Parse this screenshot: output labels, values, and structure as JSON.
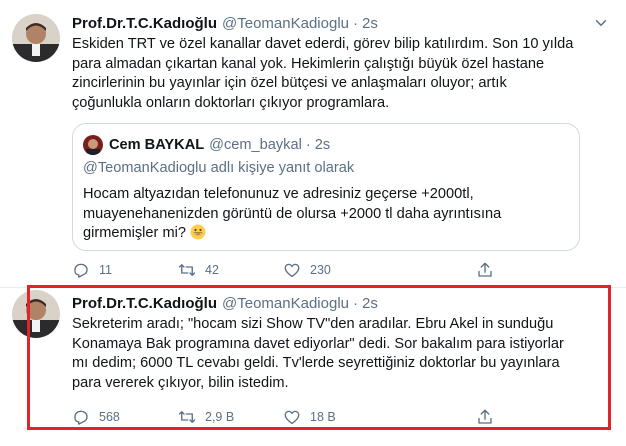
{
  "tweet1": {
    "name": "Prof.Dr.T.C.Kadıoğlu",
    "handle": "@TeomanKadioglu",
    "separator": "·",
    "time": "2s",
    "text": "Eskiden TRT ve özel kanallar davet ederdi, görev bilip katılırdım. Son 10 yılda\npara almadan çıkartan kanal yok. Hekimlerin çalıştığı büyük özel hastane\nzincirlerinin bu yayınlar için özel bütçesi ve anlaşmaları oluyor; artık\nçoğunlukla onların doktorları çıkıyor programlara.",
    "quote": {
      "name": "Cem BAYKAL",
      "handle": "@cem_baykal",
      "separator": "·",
      "time": "2s",
      "reply_context": "@TeomanKadioglu adlı kişiye yanıt olarak",
      "text": "Hocam altyazıdan telefonunuz ve adresiniz geçerse +2000tl,\nmuayenehanenizden görüntü de olursa +2000 tl daha ayrıntısına\ngirmemişler mi?",
      "emoji": "grinning-face"
    },
    "actions": {
      "replies": "11",
      "retweets": "42",
      "likes": "230"
    }
  },
  "tweet2": {
    "name": "Prof.Dr.T.C.Kadıoğlu",
    "handle": "@TeomanKadioglu",
    "separator": "·",
    "time": "2s",
    "text": "Sekreterim aradı; \"hocam sizi Show TV\"den aradılar. Ebru Akel in sunduğu\nKonamaya Bak programına davet ediyorlar\" dedi. Sor bakalım para istiyorlar\nmı dedim; 6000 TL cevabı geldi. Tv'lerde seyrettiğiniz doktorlar bu yayınlara\npara vererek çıkıyor, bilin istedim.",
    "actions": {
      "replies": "568",
      "retweets": "2,9 B",
      "likes": "18 B"
    }
  },
  "colors": {
    "secondary_text": "#5b7083",
    "highlight_border": "#e0242b",
    "divider": "#e6ecf0"
  },
  "icons": [
    "reply-icon",
    "retweet-icon",
    "like-icon",
    "share-icon",
    "more-icon",
    "emoji-grinning-icon"
  ]
}
